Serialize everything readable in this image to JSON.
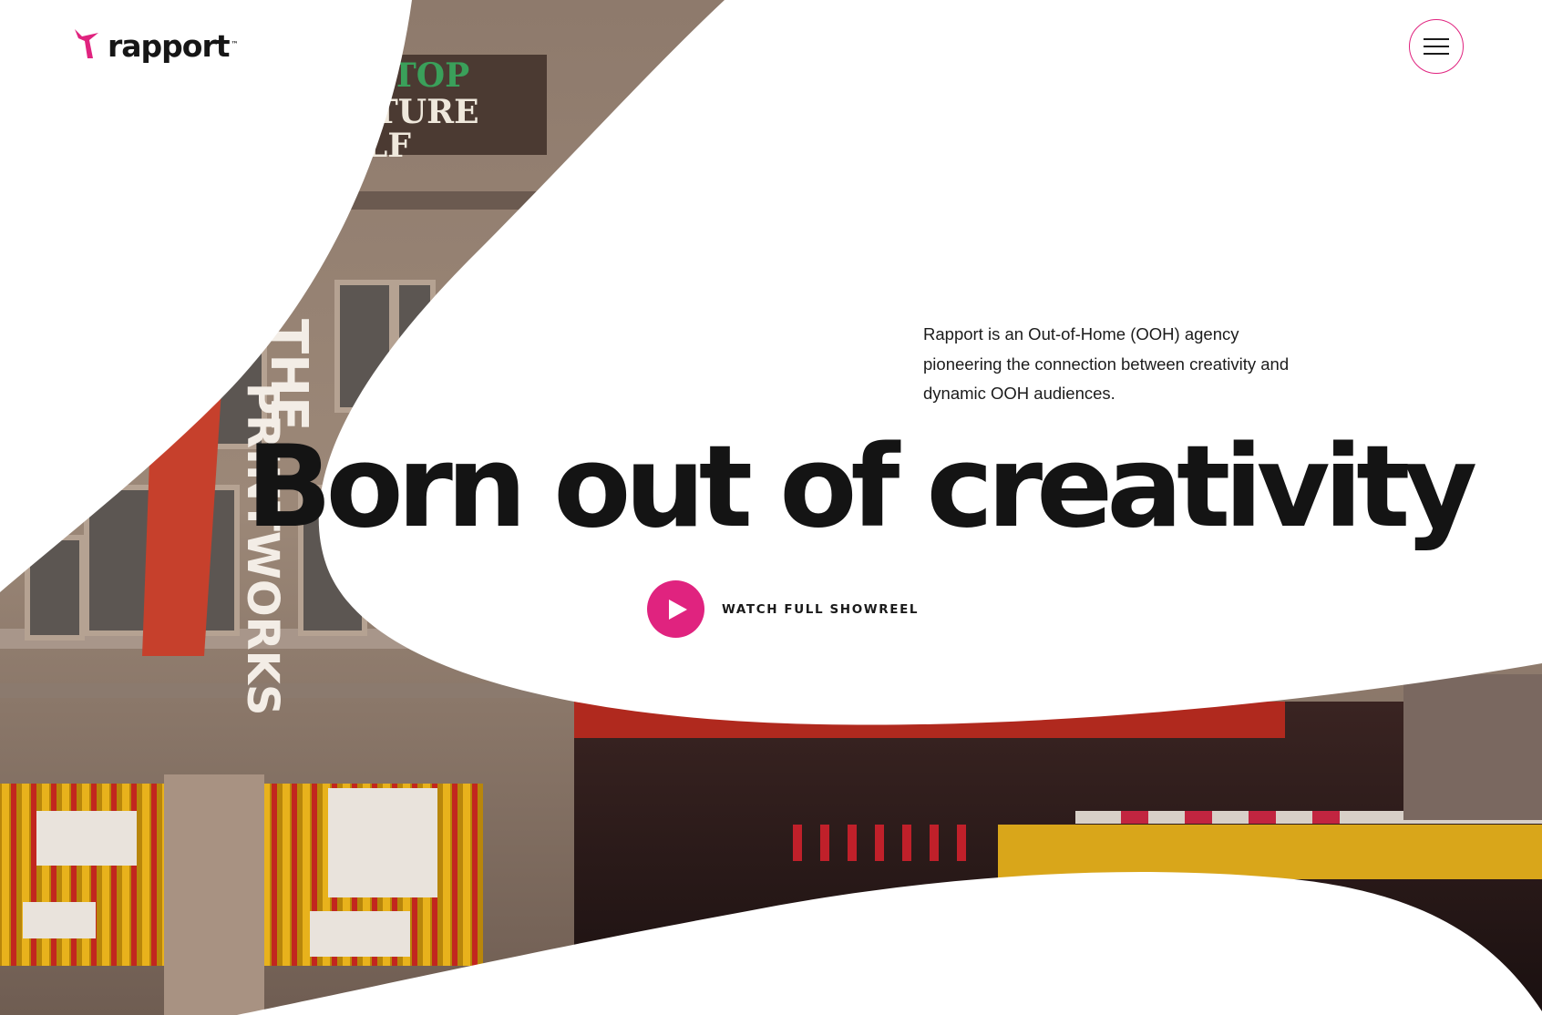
{
  "brand": {
    "name": "rapport",
    "trademark": "™",
    "accent_color": "#e0237f"
  },
  "header": {
    "menu_icon": "hamburger-menu-icon"
  },
  "hero": {
    "intro": "Rapport is an Out-of-Home (OOH) agency pioneering the connection between creativity and dynamic OOH audiences.",
    "headline": "Born out of creativity",
    "showreel_label": "WATCH FULL SHOWREEL",
    "showreel_icon": "play-icon",
    "background_image": "printworks-building-photo"
  }
}
